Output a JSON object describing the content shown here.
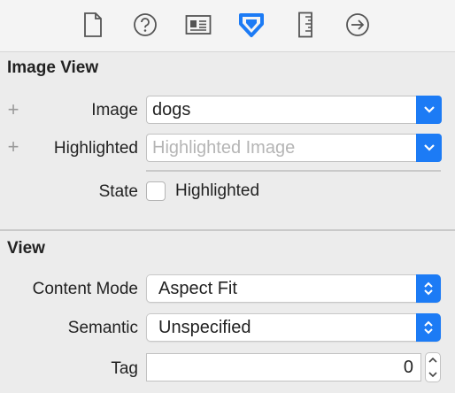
{
  "toolbar": {
    "icons": [
      "file-icon",
      "help-icon",
      "identity-icon",
      "attributes-icon",
      "size-icon",
      "connections-icon"
    ]
  },
  "image_view": {
    "title": "Image View",
    "image_label": "Image",
    "image_value": "dogs",
    "highlighted_label": "Highlighted",
    "highlighted_placeholder": "Highlighted Image",
    "state_label": "State",
    "state_checkbox_label": "Highlighted",
    "state_checked": false
  },
  "view": {
    "title": "View",
    "content_mode_label": "Content Mode",
    "content_mode_value": "Aspect Fit",
    "semantic_label": "Semantic",
    "semantic_value": "Unspecified",
    "tag_label": "Tag",
    "tag_value": "0"
  },
  "colors": {
    "accent": "#1c7bf5",
    "background": "#ececec"
  }
}
